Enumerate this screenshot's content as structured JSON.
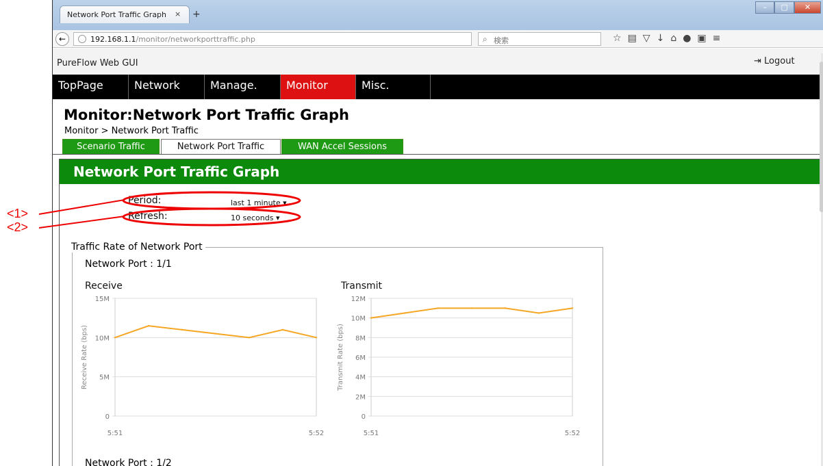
{
  "browser": {
    "tab_title": "Network Port Traffic Graph",
    "tab_close": "×",
    "new_tab": "+",
    "url_host": "192.168.1.1",
    "url_path": "/monitor/networkporttraffic.php",
    "search_placeholder": "検索",
    "win_min": "–",
    "win_max": "▢",
    "win_close": "✕"
  },
  "app": {
    "title": "PureFlow Web GUI",
    "logout_label": "Logout"
  },
  "menu": [
    {
      "label": "TopPage",
      "active": false
    },
    {
      "label": "Network",
      "active": false
    },
    {
      "label": "Manage.",
      "active": false
    },
    {
      "label": "Monitor",
      "active": true
    },
    {
      "label": "Misc.",
      "active": false
    }
  ],
  "page": {
    "heading": "Monitor:Network Port Traffic Graph",
    "breadcrumb": "Monitor > Network Port Traffic"
  },
  "subtabs": [
    {
      "label": "Scenario Traffic",
      "selected": false
    },
    {
      "label": "Network Port Traffic",
      "selected": true
    },
    {
      "label": "WAN Accel Sessions",
      "selected": false
    }
  ],
  "panel": {
    "title": "Network Port Traffic Graph",
    "period_label": "Period:",
    "period_value": "last 1 minute",
    "refresh_label": "Refresh:",
    "refresh_value": "10 seconds",
    "fieldset_legend": "Traffic Rate of Network Port",
    "port1_label": "Network Port : 1/1",
    "port2_label": "Network Port : 1/2"
  },
  "annotations": {
    "one": "<1>",
    "two": "<2>"
  },
  "colors": {
    "menu_active": "#dd1111",
    "panel_header": "#0b8a0b",
    "line": "#f5a623",
    "annotation": "#ee0000"
  },
  "chart_data": [
    {
      "type": "line",
      "title": "Receive",
      "ylabel": "Receive Rate (bps)",
      "x_ticks": [
        "5:51",
        "5:52"
      ],
      "y_ticks": [
        "0",
        "5M",
        "10M",
        "15M"
      ],
      "ylim": [
        0,
        15000000
      ],
      "x": [
        0,
        1,
        2,
        3,
        4,
        5,
        6
      ],
      "values": [
        10000000,
        11500000,
        11000000,
        10500000,
        10000000,
        11000000,
        10000000
      ],
      "grid": true
    },
    {
      "type": "line",
      "title": "Transmit",
      "ylabel": "Transmit Rate (bps)",
      "x_ticks": [
        "5:51",
        "5:52"
      ],
      "y_ticks": [
        "0",
        "2M",
        "4M",
        "6M",
        "8M",
        "10M",
        "12M"
      ],
      "ylim": [
        0,
        12000000
      ],
      "x": [
        0,
        1,
        2,
        3,
        4,
        5,
        6
      ],
      "values": [
        10000000,
        10500000,
        11000000,
        11000000,
        11000000,
        10500000,
        11000000
      ],
      "grid": true
    }
  ]
}
